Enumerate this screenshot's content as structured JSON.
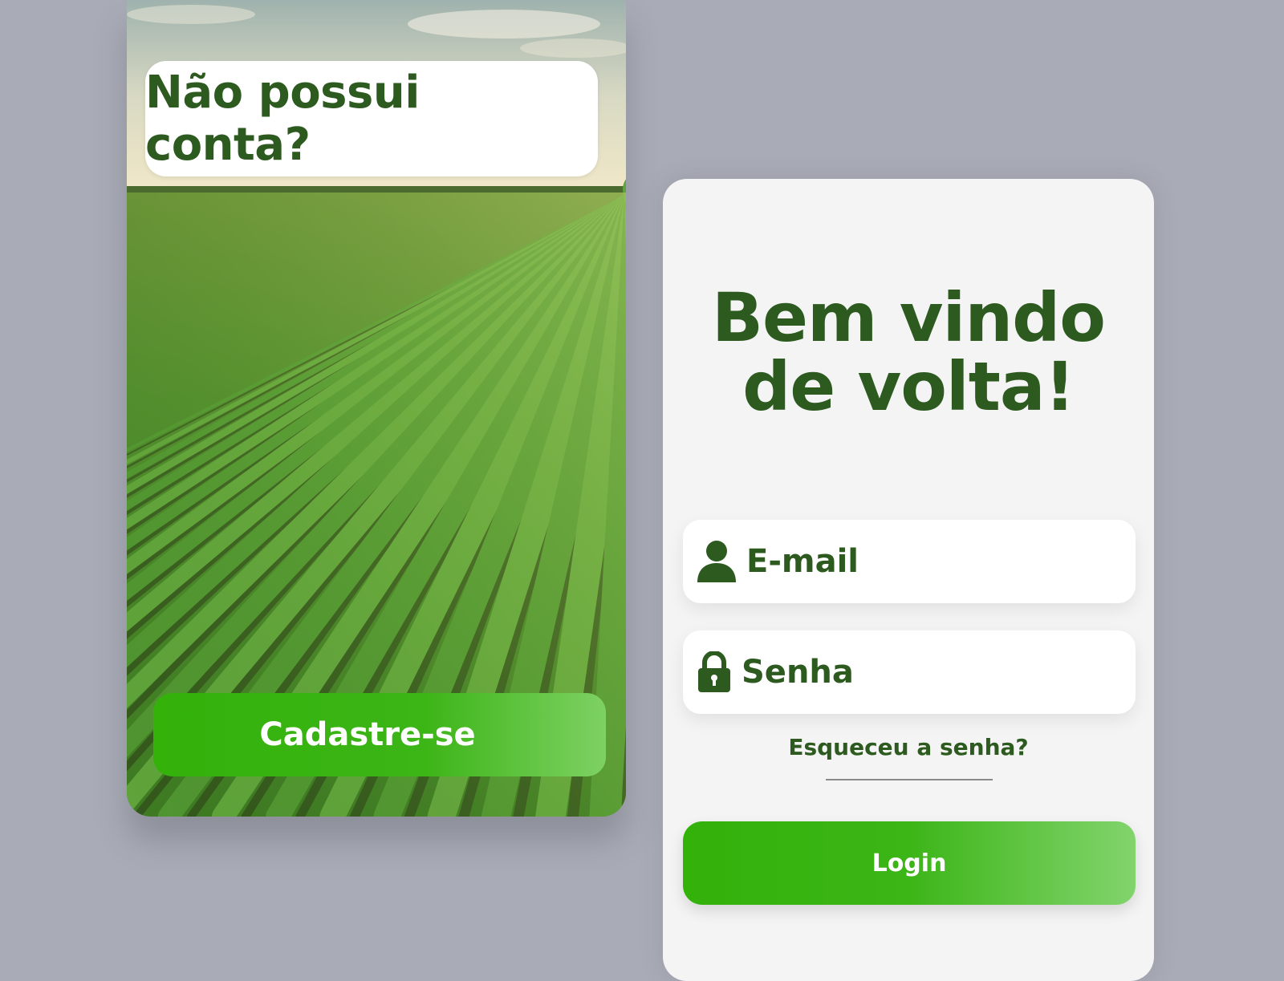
{
  "signup_panel": {
    "prompt": "Não possui conta?",
    "signup_button": "Cadastre-se"
  },
  "login_panel": {
    "title_line1": "Bem vindo",
    "title_line2": "de volta!",
    "email": {
      "placeholder": "E-mail",
      "icon": "user-icon"
    },
    "password": {
      "placeholder": "Senha",
      "icon": "lock-icon"
    },
    "forgot_password": "Esqueceu a senha?",
    "login_button": "Login"
  },
  "colors": {
    "brand_green": "#2c5a1f",
    "button_green": "#3cb517",
    "background": "#a9acb7",
    "card": "#f4f4f4"
  }
}
